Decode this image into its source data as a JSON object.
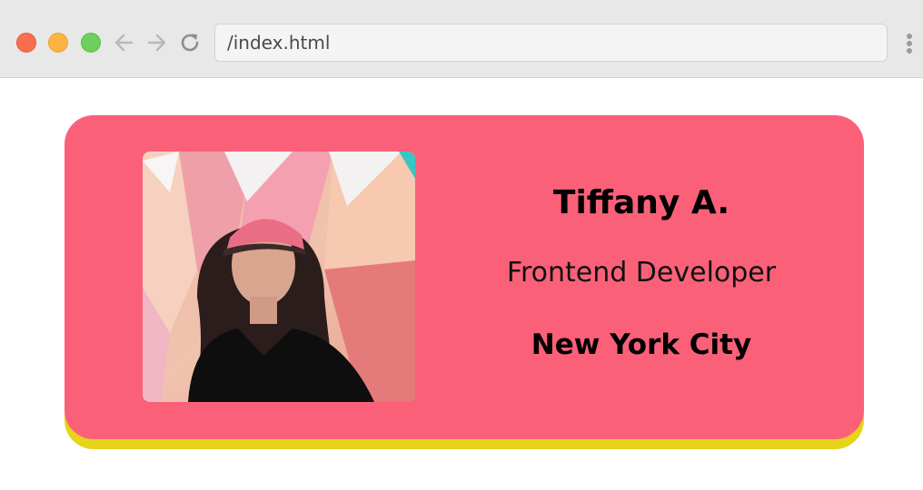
{
  "browser": {
    "url": "/index.html",
    "icons": [
      "close-icon",
      "minimize-icon",
      "maximize-icon",
      "back-arrow-icon",
      "forward-arrow-icon",
      "reload-icon",
      "more-vertical-icon"
    ]
  },
  "profile_card": {
    "name": "Tiffany A.",
    "role": "Frontend Developer",
    "location": "New York City",
    "photo_alt": "",
    "colors": {
      "card_background": "#fb6079",
      "card_shadow": "#e6d31a"
    }
  }
}
